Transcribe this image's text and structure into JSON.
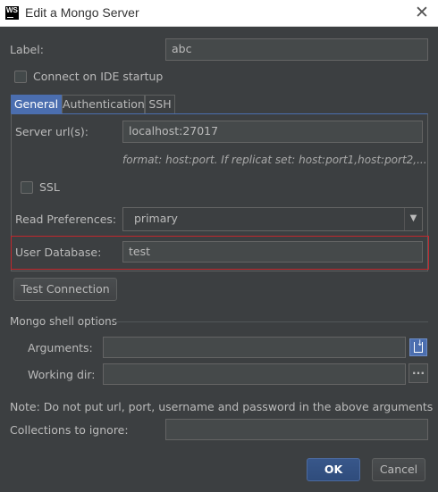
{
  "window": {
    "title": "Edit a Mongo Server",
    "logo_text": "WS"
  },
  "form": {
    "label_caption": "Label:",
    "label_value": "abc",
    "connect_on_startup": "Connect on IDE startup"
  },
  "tabs": [
    {
      "label": "General",
      "active": true
    },
    {
      "label": "Authentication",
      "active": false
    },
    {
      "label": "SSH",
      "active": false
    }
  ],
  "general": {
    "server_url_caption": "Server url(s):",
    "server_url_value": "localhost:27017",
    "format_hint": "format: host:port. If replicat set: host:port1,host:port2,...",
    "ssl_label": "SSL",
    "read_pref_caption": "Read  Preferences:",
    "read_pref_value": "primary",
    "user_db_caption": "User Database:",
    "user_db_value": "test"
  },
  "buttons": {
    "test_connection": "Test Connection",
    "ok": "OK",
    "cancel": "Cancel"
  },
  "shell": {
    "section_title": "Mongo shell options",
    "arguments_caption": "Arguments:",
    "arguments_value": "",
    "working_dir_caption": "Working dir:",
    "working_dir_value": "",
    "browse_label": "..."
  },
  "note": "Note: Do not put url, port, username and password in the above arguments",
  "collections": {
    "caption": "Collections to ignore:",
    "value": ""
  },
  "colors": {
    "background": "#3c3f41",
    "accent": "#4b6eaf",
    "highlight": "#c2272d"
  }
}
